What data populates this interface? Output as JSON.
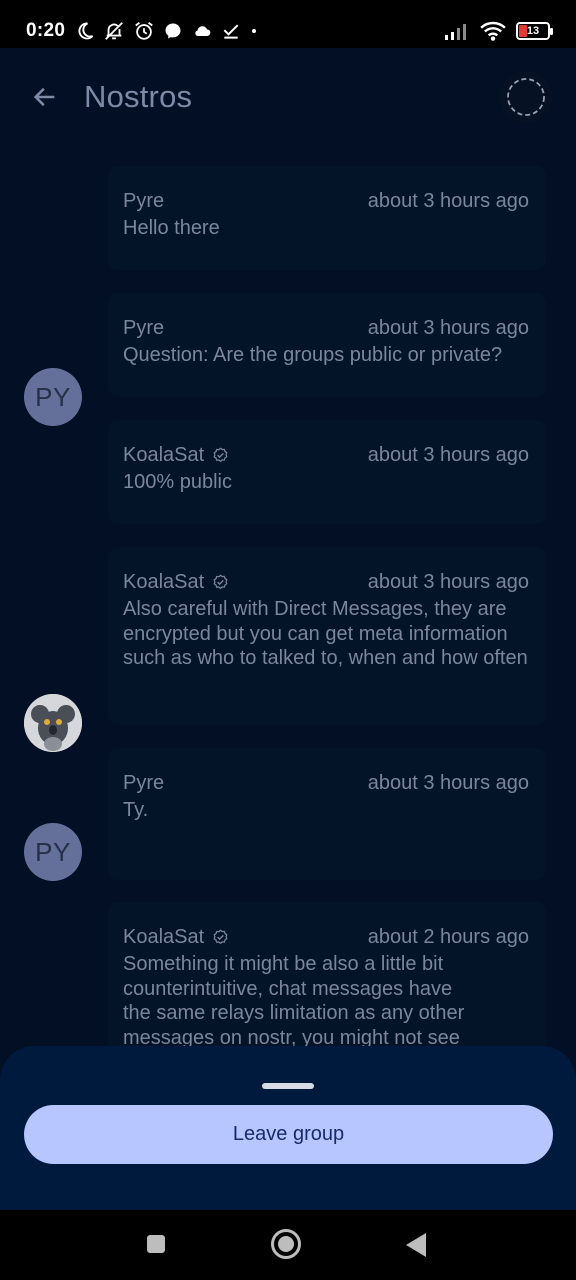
{
  "status_bar": {
    "time": "0:20",
    "battery_level": "13",
    "icons": [
      "moon-icon",
      "bell-off-icon",
      "alarm-icon",
      "messenger-icon",
      "cloud-icon",
      "download-done-icon",
      "dot-icon",
      "signal-icon",
      "wifi-icon",
      "battery-icon"
    ]
  },
  "header": {
    "title": "Nostros"
  },
  "messages": [
    {
      "author": "Pyre",
      "verified": false,
      "time": "about 3 hours ago",
      "text": "Hello there",
      "avatar": null
    },
    {
      "author": "Pyre",
      "verified": false,
      "time": "about 3 hours ago",
      "text": "Question: Are the groups public or private?",
      "avatar": "PY"
    },
    {
      "author": "KoalaSat",
      "verified": true,
      "time": "about 3 hours ago",
      "text": "100% public",
      "avatar": null
    },
    {
      "author": "KoalaSat",
      "verified": true,
      "time": "about 3 hours ago",
      "text": "Also careful with Direct Messages, they are encrypted but you can get meta information such as who to talked to, when and how often",
      "avatar": "koala"
    },
    {
      "author": "Pyre",
      "verified": false,
      "time": "about 3 hours ago",
      "text": "Ty.",
      "avatar": "PY"
    },
    {
      "author": "KoalaSat",
      "verified": true,
      "time": "about 2 hours ago",
      "text": "Something it might be also a little bit counterintuitive, chat messages have the same relays limitation as any other messages on nostr, you might not see some texts people are answering to, because you can't find it on your relays!",
      "avatar": "koala"
    }
  ],
  "sheet": {
    "leave_label": "Leave group"
  },
  "colors": {
    "background": "#020f24",
    "bubble": "#031328",
    "sheet": "#001a3d",
    "button": "#b7c6ff",
    "button_text": "#172b6c"
  }
}
